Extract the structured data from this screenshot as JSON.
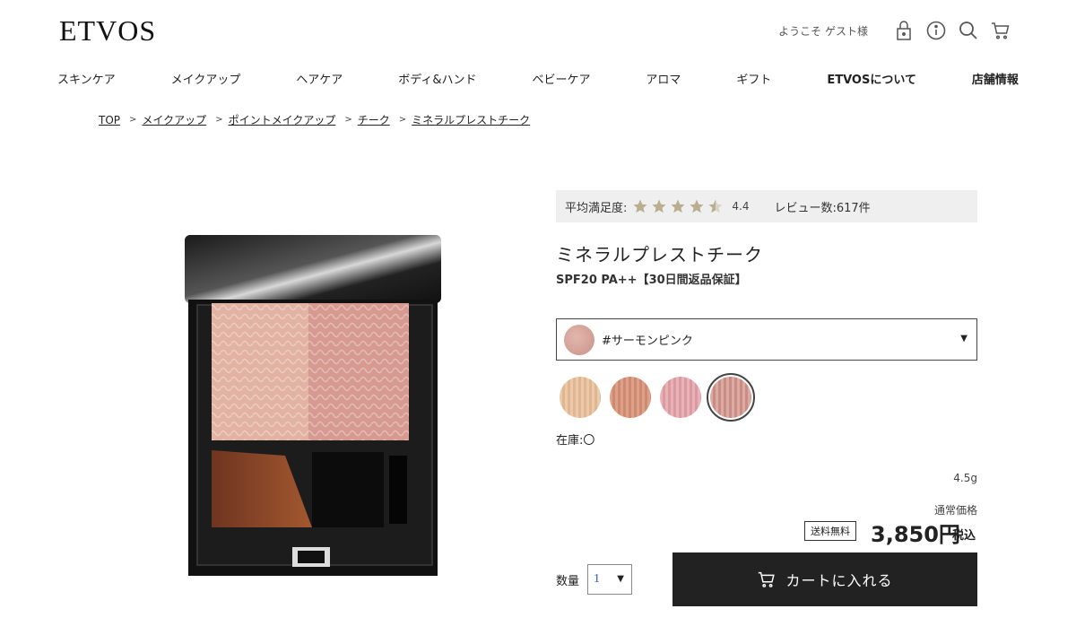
{
  "header": {
    "logo": "ETVOS",
    "welcome": "ようこそ ゲスト様",
    "icons": [
      "lock-icon",
      "info-icon",
      "search-icon",
      "cart-icon"
    ]
  },
  "nav": [
    {
      "label": "スキンケア"
    },
    {
      "label": "メイクアップ"
    },
    {
      "label": "ヘアケア"
    },
    {
      "label": "ボディ&ハンド"
    },
    {
      "label": "ベビーケア"
    },
    {
      "label": "アロマ"
    },
    {
      "label": "ギフト"
    },
    {
      "label": "ETVOSについて"
    },
    {
      "label": "店舗情報"
    }
  ],
  "breadcrumb": [
    {
      "label": "TOP"
    },
    {
      "label": "メイクアップ"
    },
    {
      "label": "ポイントメイクアップ"
    },
    {
      "label": "チーク"
    },
    {
      "label": "ミネラルプレストチーク"
    }
  ],
  "product": {
    "rating_label": "平均満足度:",
    "rating_value": "4.4",
    "rating_stars": 4.4,
    "review_count": "レビュー数:617件",
    "title": "ミネラルプレストチーク",
    "subtitle": "SPF20 PA++【30日間返品保証】",
    "selected_color": "#サーモンピンク",
    "swatches": [
      {
        "color": "#e9c4a6"
      },
      {
        "color": "#d89a80"
      },
      {
        "color": "#e5a9b0"
      },
      {
        "color": "#d29e94"
      }
    ],
    "stock": "在庫:〇",
    "weight": "4.5g",
    "price_label": "通常価格",
    "shipping_badge": "送料無料",
    "price": "3,850円",
    "tax": "税込",
    "qty_label": "数量",
    "qty_value": "1",
    "cart_button": "カートに入れる"
  },
  "colors": {
    "cart_button_bg": "#222222",
    "rating_bar_bg": "#efefef",
    "star": "#b9ae8f"
  }
}
